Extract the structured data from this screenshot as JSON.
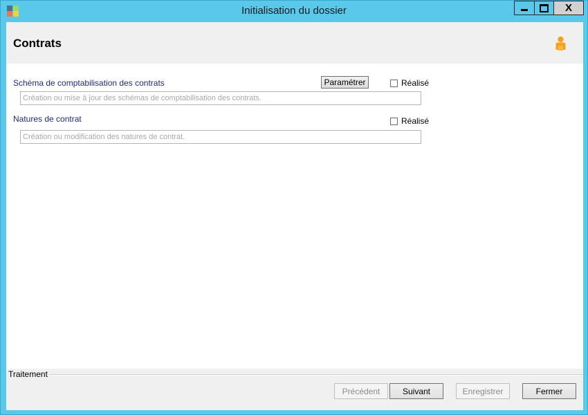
{
  "window": {
    "title": "Initialisation du dossier",
    "close_symbol": "X"
  },
  "header": {
    "title": "Contrats",
    "user_icon": "user-icon"
  },
  "sections": [
    {
      "label": "Schéma de comptabilisation des contrats",
      "button_label": "Paramétrer",
      "done_label": "Réalisé",
      "done_checked": false,
      "description": "Création ou mise à jour des schémas de comptabilisation des contrats."
    },
    {
      "label": "Natures de contrat",
      "done_label": "Réalisé",
      "done_checked": false,
      "description": "Création ou modification des natures de contrat."
    }
  ],
  "footer": {
    "group_label": "Traitement",
    "buttons": {
      "previous": "Précédent",
      "next": "Suivant",
      "save": "Enregistrer",
      "close": "Fermer"
    }
  },
  "colors": {
    "titlebar": "#5ac8ea",
    "label_text": "#1f2b7a",
    "panel_bg": "#f0f0f0"
  }
}
